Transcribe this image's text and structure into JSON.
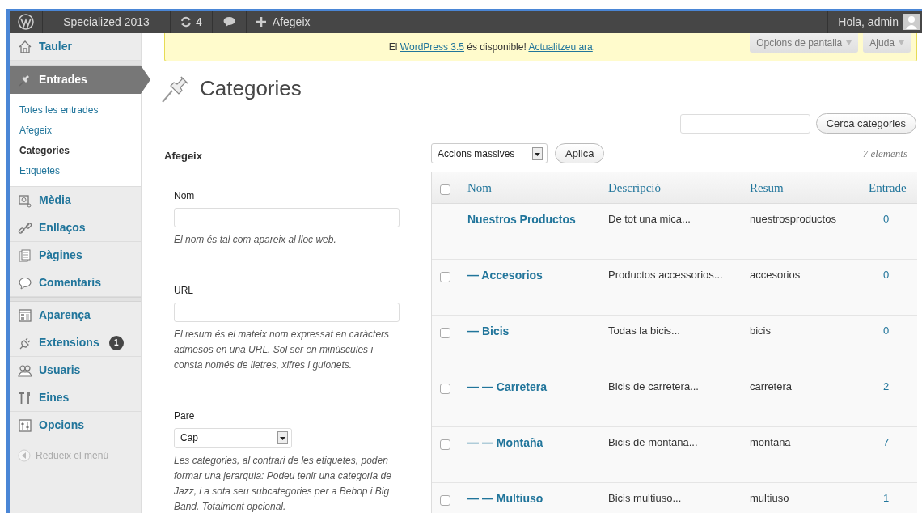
{
  "admin_bar": {
    "site": "Specialized 2013",
    "updates": "4",
    "new_label": "Afegeix",
    "greeting": "Hola, admin"
  },
  "sidebar": {
    "groups": [
      [
        {
          "label": "Tauler",
          "selected": false
        }
      ],
      [
        {
          "label": "Entrades",
          "selected": true,
          "submenu": [
            {
              "label": "Totes les entrades",
              "selected": false
            },
            {
              "label": "Afegeix",
              "selected": false
            },
            {
              "label": "Categories",
              "selected": true
            },
            {
              "label": "Etiquetes",
              "selected": false
            }
          ]
        },
        {
          "label": "Mèdia",
          "selected": false
        },
        {
          "label": "Enllaços",
          "selected": false
        },
        {
          "label": "Pàgines",
          "selected": false
        },
        {
          "label": "Comentaris",
          "selected": false
        }
      ],
      [
        {
          "label": "Aparença",
          "selected": false
        },
        {
          "label": "Extensions",
          "selected": false,
          "badge": "1"
        },
        {
          "label": "Usuaris",
          "selected": false
        },
        {
          "label": "Eines",
          "selected": false
        },
        {
          "label": "Opcions",
          "selected": false
        }
      ]
    ],
    "collapse": "Redueix el menú"
  },
  "notice": {
    "parts": [
      {
        "text": "El ",
        "link": false
      },
      {
        "text": "WordPress 3.5",
        "link": true
      },
      {
        "text": " és disponible! ",
        "link": false
      },
      {
        "text": "Actualitzeu ara",
        "link": true
      },
      {
        "text": ".",
        "link": false
      }
    ]
  },
  "screen_meta": [
    "Opcions de pantalla",
    "Ajuda"
  ],
  "page_title": "Categories",
  "search_button": "Cerca categories",
  "add_form": {
    "heading": "Afegeix",
    "fields": [
      {
        "kind": "text",
        "label": "Nom",
        "help": "El nom és tal com apareix al lloc web."
      },
      {
        "kind": "text",
        "label": "URL",
        "help": "El resum és el mateix nom expressat en caràcters admesos en una URL. Sol ser en minúscules i consta només de lletres, xifres i guionets."
      },
      {
        "kind": "select",
        "label": "Pare",
        "value": "Cap",
        "help": "Les categories, al contrari de les etiquetes, poden formar una jerarquia: Podeu tenir una categoria de Jazz, i a sota seu subcategories per a Bebop i Big Band. Totalment opcional."
      }
    ]
  },
  "bulk_actions": {
    "value": "Accions massives",
    "button": "Aplica"
  },
  "item_count": "7 elements",
  "table": {
    "header_checked": false,
    "columns": [
      "Nom",
      "Descripció",
      "Resum",
      "Entrade"
    ],
    "rows": [
      {
        "name": "Nuestros Productos",
        "description": "De tot una mica...",
        "slug": "nuestrosproductos",
        "count": "0"
      },
      {
        "name": "— Accesorios",
        "description": "Productos accessorios...",
        "slug": "accesorios",
        "count": "0",
        "checked": false
      },
      {
        "name": "— Bicis",
        "description": "Todas la bicis...",
        "slug": "bicis",
        "count": "0",
        "checked": false
      },
      {
        "name": "— — Carretera",
        "description": "Bicis de carretera...",
        "slug": "carretera",
        "count": "2",
        "checked": false
      },
      {
        "name": "— — Montaña",
        "description": "Bicis de montaña...",
        "slug": "montana",
        "count": "7",
        "checked": false
      },
      {
        "name": "— — Multiuso",
        "description": "Bicis multiuso...",
        "slug": "multiuso",
        "count": "1",
        "checked": false
      }
    ]
  }
}
